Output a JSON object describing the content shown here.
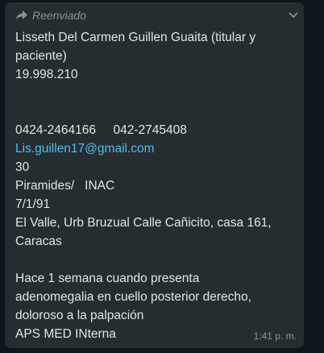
{
  "message": {
    "forward_label": "Reenviado",
    "lines": [
      "Lisseth Del Carmen Guillen Guaita (titular y",
      "paciente)",
      "19.998.210",
      "",
      "",
      "0424-2464166     042-2745408",
      "Lis.guillen17@gmail.com",
      "30",
      "Piramides/   INAC",
      "7/1/91",
      "El Valle, Urb Bruzual Calle Cañicito, casa 161,",
      "Caracas",
      "",
      "Hace 1 semana cuando presenta",
      "adenomegalia en cuello posterior derecho,",
      "doloroso a la palpación",
      "APS MED INterna"
    ],
    "time": "1:41 p. m."
  },
  "icons": {
    "forward": "forward-arrow-icon",
    "menu": "chevron-down-icon"
  },
  "colors": {
    "bubble": "#262d31",
    "text": "#e1e4e6",
    "link": "#53bdeb",
    "meta": "#8a9094",
    "background": "#0d171b"
  }
}
